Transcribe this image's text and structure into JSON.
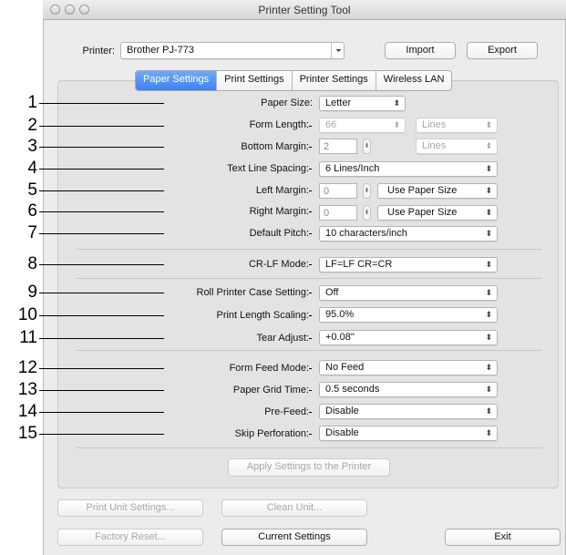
{
  "window": {
    "title": "Printer Setting Tool"
  },
  "printer_row": {
    "label": "Printer:",
    "value": "Brother PJ-773",
    "import_label": "Import",
    "export_label": "Export"
  },
  "tabs": [
    {
      "label": "Paper Settings",
      "selected": true
    },
    {
      "label": "Print Settings",
      "selected": false
    },
    {
      "label": "Printer Settings",
      "selected": false
    },
    {
      "label": "Wireless LAN",
      "selected": false
    }
  ],
  "settings": {
    "paper_size": {
      "num": "1",
      "label": "Paper Size:",
      "value": "Letter"
    },
    "form_length": {
      "num": "2",
      "label": "Form Length:",
      "value": "66",
      "unit": "Lines"
    },
    "bottom_margin": {
      "num": "3",
      "label": "Bottom Margin:",
      "value": "2",
      "unit": "Lines"
    },
    "text_line_spacing": {
      "num": "4",
      "label": "Text Line Spacing:",
      "value": "6 Lines/Inch"
    },
    "left_margin": {
      "num": "5",
      "label": "Left Margin:",
      "value": "0",
      "unit": "Use Paper Size"
    },
    "right_margin": {
      "num": "6",
      "label": "Right Margin:",
      "value": "0",
      "unit": "Use Paper Size"
    },
    "default_pitch": {
      "num": "7",
      "label": "Default Pitch:",
      "value": "10 characters/inch"
    },
    "cr_lf_mode": {
      "num": "8",
      "label": "CR-LF Mode:",
      "value": "LF=LF CR=CR"
    },
    "roll_printer_case": {
      "num": "9",
      "label": "Roll Printer Case Setting:",
      "value": "Off"
    },
    "print_length_scaling": {
      "num": "10",
      "label": "Print Length Scaling:",
      "value": "95.0%"
    },
    "tear_adjust": {
      "num": "11",
      "label": "Tear Adjust:",
      "value": "+0.08\""
    },
    "form_feed_mode": {
      "num": "12",
      "label": "Form Feed Mode:",
      "value": "No Feed"
    },
    "paper_grid_time": {
      "num": "13",
      "label": "Paper Grid Time:",
      "value": "0.5 seconds"
    },
    "pre_feed": {
      "num": "14",
      "label": "Pre-Feed:",
      "value": "Disable"
    },
    "skip_perforation": {
      "num": "15",
      "label": "Skip Perforation:",
      "value": "Disable"
    }
  },
  "buttons": {
    "apply": "Apply Settings to the Printer",
    "print_unit": "Print Unit Settings...",
    "clean_unit": "Clean Unit...",
    "factory_reset": "Factory Reset...",
    "current_settings": "Current Settings",
    "exit": "Exit"
  },
  "icons": {
    "popup_arrow": "⌃⌄",
    "stepper": "stepper-icon"
  }
}
